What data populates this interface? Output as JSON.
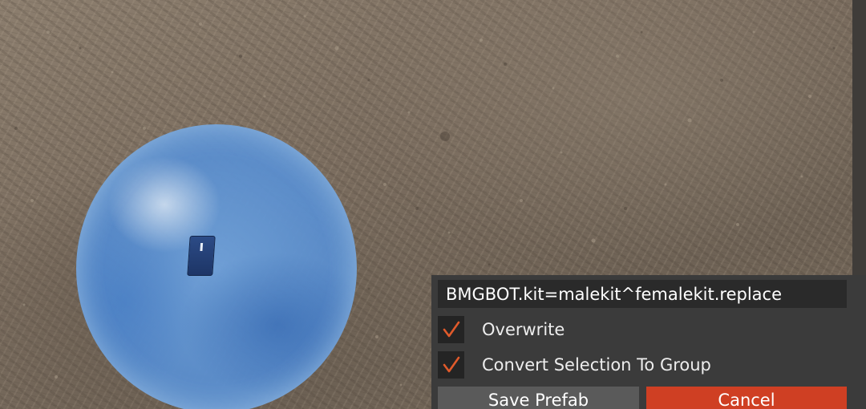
{
  "prefab_dialog": {
    "name_value": "BMGBOT.kit=malekit^femalekit.replace",
    "options": [
      {
        "label": "Overwrite",
        "checked": true
      },
      {
        "label": "Convert Selection To Group",
        "checked": true
      }
    ],
    "save_label": "Save Prefab",
    "cancel_label": "Cancel"
  },
  "icons": {
    "check": "checkmark-icon"
  },
  "colors": {
    "panel_bg": "#3b3b3b",
    "field_bg": "#2a2a2a",
    "checkmark": "#e05a2b",
    "cancel_button": "#cf3f23",
    "save_button": "#5a5a5a",
    "selection_sphere": "#5b8fcf"
  }
}
